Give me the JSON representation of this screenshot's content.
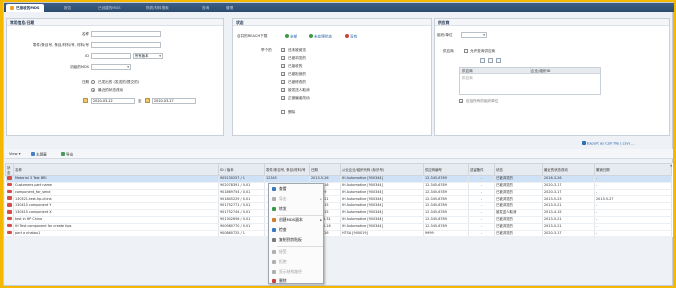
{
  "tabs": [
    {
      "label": "已接收的MDS",
      "active": true
    },
    {
      "label": "报告"
    },
    {
      "label": "已创建的MDS"
    },
    {
      "label": "物质/材料搜索"
    },
    {
      "label": "查询"
    },
    {
      "label": "管理"
    }
  ],
  "search": {
    "title": "常用信息/日期",
    "name_label": "名称",
    "part_label": "零件/条目号, 条目/材料/号, 材料/号",
    "id_label": "ID",
    "id_select": "所有版本",
    "mds_id_label": "初级的MDS",
    "date_label": "日期",
    "opt_sent_label": "已发出的 (发送的/提交的)",
    "opt_latest_label": "最近的状态改动",
    "from_date": "2020-03-12",
    "to_label": "至",
    "to_date": "2020-03-17"
  },
  "status": {
    "title": "状态",
    "reach_label": "合并的REACH下载",
    "all_label": "全部",
    "unread_label": "未处理状态",
    "none_label": "没有",
    "group_label": "举个的",
    "items": [
      {
        "label": "还未被阅览",
        "checked": true
      },
      {
        "label": "已被浏览的",
        "checked": true
      },
      {
        "label": "已接收的",
        "checked": true
      },
      {
        "label": "已被拒绝的",
        "checked": true
      },
      {
        "label": "已被修改的",
        "checked": true
      },
      {
        "label": "被发送人取消",
        "checked": true
      },
      {
        "label": "正被编者改动",
        "checked": true
      }
    ],
    "deleted_label": "删除",
    "deleted_checked": false
  },
  "supplier": {
    "title": "供应商",
    "org_label": "组织/单位",
    "supplier_label": "供应商",
    "allow_label": "允许查询供应商",
    "col1": "供应商",
    "col2": "企业/组织ID",
    "row_text": "供应商",
    "include_label": "包括所有的组织单位"
  },
  "toolbar": {
    "view_label": "View",
    "main_label": "主屏幕",
    "export_label": "导出",
    "csv_label": "Export as CSV file (.csv) ..."
  },
  "table": {
    "headers": [
      "状态",
      "名称",
      "ID / 版本",
      "零件/条目号, 条目/材料/号",
      "日期",
      "从业企业/组织代码 (标识号)",
      "供应商编号",
      "遗留备件",
      "状态",
      "最近的状态改动",
      "撤销日期"
    ],
    "rows": [
      {
        "name": "Material 3 Test BRI",
        "id": "905130257 / 1",
        "part": "12345",
        "date": "2013-5-26",
        "company": "IH Automotive [900344]",
        "sup_no": "12-345-6789",
        "legacy": "-",
        "status": "已被浏览的",
        "last_change": "2016-3-26",
        "revoke": "-",
        "selected": true
      },
      {
        "name": "Customers part name",
        "id": "902078391 / 0.01",
        "part": "",
        "date": "2016-3-26",
        "company": "IH Automotive [900344]",
        "sup_no": "12-345-6789",
        "legacy": "-",
        "status": "已被浏览的",
        "last_change": "2020-3-17",
        "revoke": "-"
      },
      {
        "name": "component_for_send",
        "id": "901869754 / 0.01",
        "part": "",
        "date": "2016-3-9",
        "company": "IH Automotive [900344]",
        "sup_no": "12-345-6789",
        "legacy": "-",
        "status": "已被浏览的",
        "last_change": "2020-3-17",
        "revoke": "-"
      },
      {
        "name": "130521-test-hp-china",
        "id": "901845229 / 0.01",
        "part": "",
        "date": "2013-5-21",
        "company": "IH Automotive [900344]",
        "sup_no": "12-345-6789",
        "legacy": "-",
        "status": "已被浏览的",
        "last_change": "2013-5-23",
        "revoke": "2013-5-27"
      },
      {
        "name": "130415 component Y",
        "id": "901752771 / 0.01",
        "part": "",
        "date": "2013-4-15",
        "company": "IH Automotive [900344]",
        "sup_no": "12-345-6789",
        "legacy": "-",
        "status": "已被浏览的",
        "last_change": "2013-5-21",
        "revoke": "-"
      },
      {
        "name": "130415 component X",
        "id": "901752744 / 0.01",
        "part": "",
        "date": "2013-4-15",
        "company": "IH Automotive [900344]",
        "sup_no": "12-345-6789",
        "legacy": "-",
        "status": "被发送人取消",
        "last_change": "2013-4-15",
        "revoke": "-"
      },
      {
        "name": "test in HP China",
        "id": "901302656 / 0.01",
        "part": "",
        "date": "2012-10-31",
        "company": "IH Automotive [900344]",
        "sup_no": "12-345-6789",
        "legacy": "-",
        "status": "已被浏览的",
        "last_change": "2013-5-21",
        "revoke": "-"
      },
      {
        "name": "IH Test component for create tips",
        "id": "900980770 / 0.01",
        "part": "",
        "date": "2012-12-16",
        "company": "IH Automotive [900344]",
        "sup_no": "12-345-6789",
        "legacy": "-",
        "status": "已被浏览的",
        "last_change": "2013-5-21",
        "revoke": "-"
      },
      {
        "name": "part a nhatau1",
        "id": "900860725 / 1",
        "part": "",
        "date": "2012-3-26",
        "company": "HTSA [900019]",
        "sup_no": "9999",
        "legacy": "-",
        "status": "已被浏览的",
        "last_change": "2020-3-17",
        "revoke": "-"
      }
    ]
  },
  "context_menu": [
    {
      "label": "查看",
      "icon": "view-icon",
      "enabled": true,
      "color": "#3b78c2"
    },
    {
      "label": "导出",
      "icon": "export-icon",
      "enabled": false,
      "color": "#b0b0b0",
      "sub": true
    },
    {
      "label": "转发",
      "icon": "forward-icon",
      "enabled": true,
      "color": "#3b9a4a"
    },
    {
      "label": "创建MDS副本",
      "icon": "copy-icon",
      "enabled": true,
      "color": "#d27b2e",
      "sub": true
    },
    {
      "label": "检查",
      "icon": "check-icon",
      "enabled": true,
      "color": "#3b78c2"
    },
    {
      "label": "复制到剪贴板",
      "icon": "clipboard-icon",
      "enabled": true,
      "color": "#7a7a7a"
    },
    {
      "label": "接受",
      "icon": "accept-icon",
      "enabled": false,
      "color": "#b0b0b0"
    },
    {
      "label": "拒绝",
      "icon": "reject-icon",
      "enabled": false,
      "color": "#b0b0b0"
    },
    {
      "label": "显示结构路径",
      "icon": "tree-icon",
      "enabled": false,
      "color": "#b0b0b0"
    },
    {
      "label": "删除",
      "icon": "delete-icon",
      "enabled": true,
      "color": "#c94040"
    }
  ]
}
